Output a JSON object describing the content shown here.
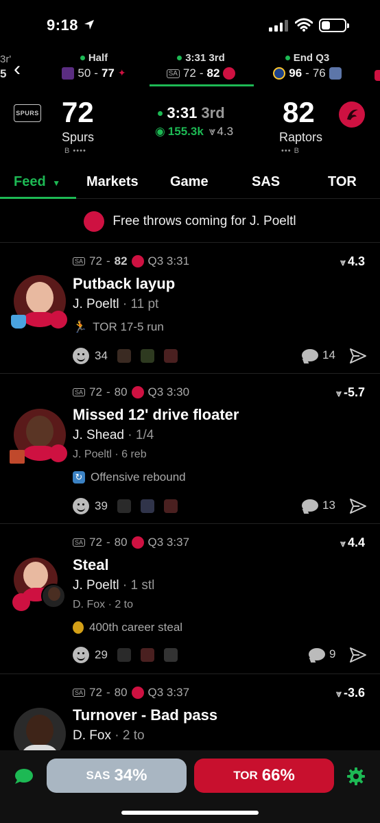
{
  "status_bar": {
    "time": "9:18"
  },
  "games_strip": {
    "edge_left_top": "3r'",
    "edge_left_bottom": "5",
    "games": [
      {
        "status": "Half",
        "away_score": "50",
        "home_score": "77",
        "selected": false
      },
      {
        "status": "3:31 3rd",
        "away_score": "72",
        "home_score": "82",
        "selected": true
      },
      {
        "status": "End Q3",
        "away_score": "96",
        "home_score": "76",
        "selected": false
      }
    ]
  },
  "scoreboard": {
    "away": {
      "score": "72",
      "name": "Spurs",
      "timeouts": "B ••••",
      "logo_text": "SPURS"
    },
    "home": {
      "score": "82",
      "name": "Raptors",
      "timeouts": "••• B"
    },
    "clock": "3:31",
    "period": "3rd",
    "watchers": "155.3k",
    "spread": "4.3"
  },
  "tabs": [
    "Feed",
    "Markets",
    "Game",
    "SAS",
    "TOR"
  ],
  "banner": {
    "text": "Free throws coming for J. Poeltl"
  },
  "feed": [
    {
      "away": "72",
      "home": "82",
      "time": "Q3 3:31",
      "delta": "4.3",
      "title": "Putback layup",
      "player": "J. Poeltl",
      "player_stat": "11 pt",
      "sub": "",
      "note": "TOR 17-5 run",
      "reactions": "34",
      "comments": "14"
    },
    {
      "away": "72",
      "home": "80",
      "time": "Q3 3:30",
      "delta": "-5.7",
      "title": "Missed 12' drive floater",
      "player": "J. Shead",
      "player_stat": "1/4",
      "sub": "J. Poeltl · 6 reb",
      "note": "Offensive rebound",
      "reactions": "39",
      "comments": "13"
    },
    {
      "away": "72",
      "home": "80",
      "time": "Q3 3:37",
      "delta": "4.4",
      "title": "Steal",
      "player": "J. Poeltl",
      "player_stat": "1 stl",
      "sub": "D. Fox · 2 to",
      "note": "400th career steal",
      "reactions": "29",
      "comments": "9"
    },
    {
      "away": "72",
      "home": "80",
      "time": "Q3 3:37",
      "delta": "-3.6",
      "title": "Turnover - Bad pass",
      "player": "D. Fox",
      "player_stat": "2 to"
    }
  ],
  "bottom_bar": {
    "sas_label": "SAS",
    "sas_pct": "34%",
    "tor_label": "TOR",
    "tor_pct": "66%"
  },
  "colors": {
    "accent": "#1db954",
    "raptors_red": "#ce1141",
    "sas_button": "#a9b6c2",
    "tor_button": "#c8102e"
  }
}
